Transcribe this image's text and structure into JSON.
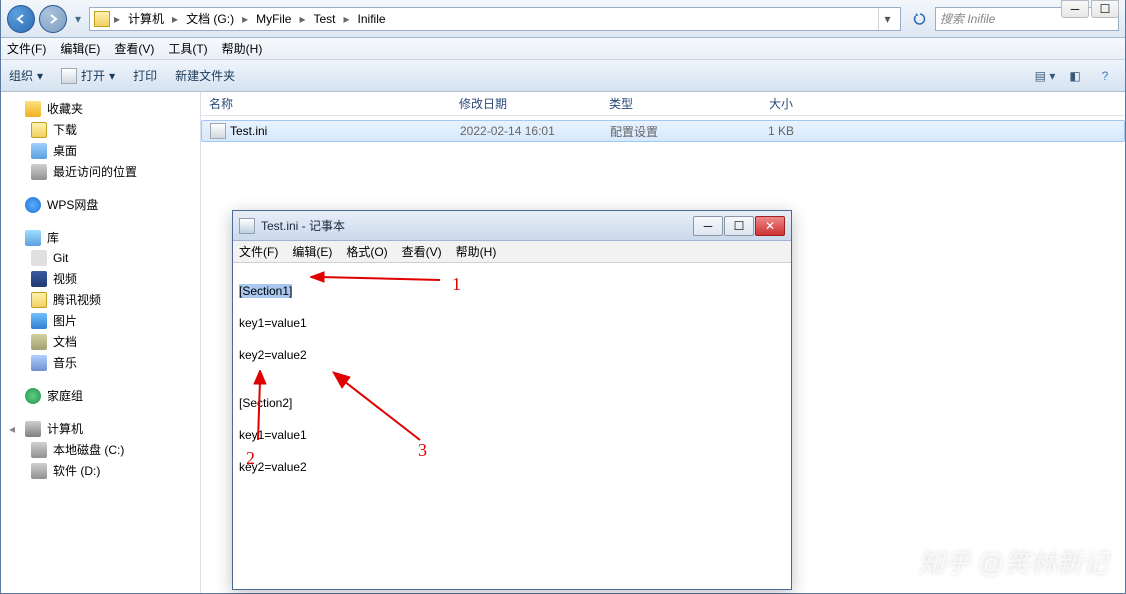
{
  "window_controls": {
    "min": "─",
    "max": "☐"
  },
  "breadcrumbs": [
    "计算机",
    "文档 (G:)",
    "MyFile",
    "Test",
    "Inifile"
  ],
  "search": {
    "placeholder": "搜索 Inifile"
  },
  "menu": {
    "file": "文件(F)",
    "edit": "编辑(E)",
    "view": "查看(V)",
    "tools": "工具(T)",
    "help": "帮助(H)"
  },
  "toolbar": {
    "organize": "组织",
    "open": "打开",
    "print": "打印",
    "newfolder": "新建文件夹"
  },
  "sidebar": {
    "favorites": {
      "label": "收藏夹",
      "items": [
        "下载",
        "桌面",
        "最近访问的位置"
      ]
    },
    "wps": {
      "label": "WPS网盘"
    },
    "libraries": {
      "label": "库",
      "items": [
        "Git",
        "视频",
        "腾讯视频",
        "图片",
        "文档",
        "音乐"
      ]
    },
    "homegroup": {
      "label": "家庭组"
    },
    "computer": {
      "label": "计算机",
      "items": [
        "本地磁盘 (C:)",
        "软件 (D:)"
      ]
    }
  },
  "columns": {
    "name": "名称",
    "date": "修改日期",
    "type": "类型",
    "size": "大小"
  },
  "files": [
    {
      "name": "Test.ini",
      "date": "2022-02-14 16:01",
      "type": "配置设置",
      "size": "1 KB"
    }
  ],
  "notepad": {
    "title": "Test.ini - 记事本",
    "menu": {
      "file": "文件(F)",
      "edit": "编辑(E)",
      "format": "格式(O)",
      "view": "查看(V)",
      "help": "帮助(H)"
    },
    "lines": [
      "[Section1]",
      "key1=value1",
      "key2=value2",
      "",
      "[Section2]",
      "key1=value1",
      "key2=value2"
    ]
  },
  "annotations": {
    "n1": "1",
    "n2": "2",
    "n3": "3"
  },
  "watermark": "知乎 @笑林新记"
}
